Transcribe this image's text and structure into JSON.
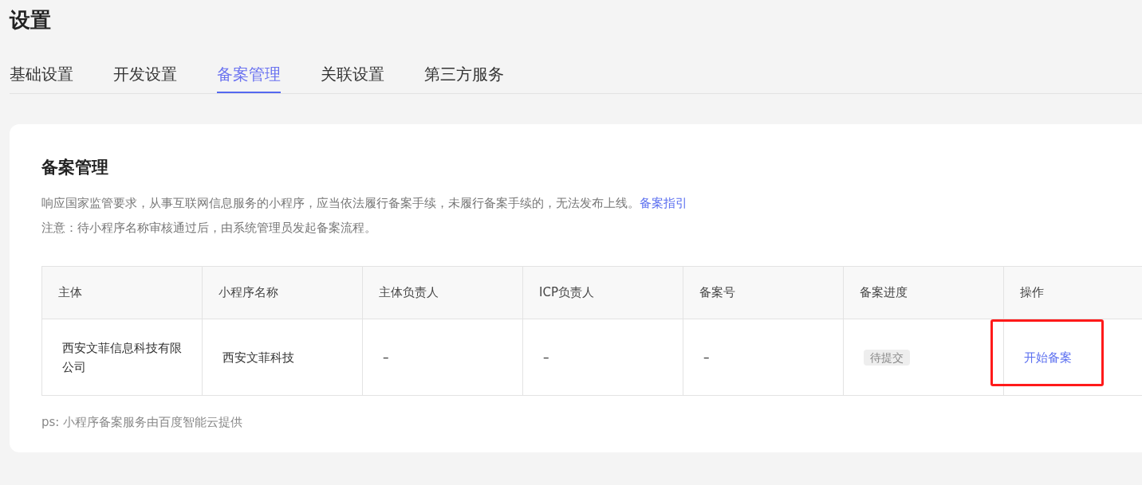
{
  "page_title": "设置",
  "tabs": [
    {
      "label": "基础设置",
      "selected": false
    },
    {
      "label": "开发设置",
      "selected": false
    },
    {
      "label": "备案管理",
      "selected": true
    },
    {
      "label": "关联设置",
      "selected": false
    },
    {
      "label": "第三方服务",
      "selected": false
    }
  ],
  "section": {
    "title": "备案管理",
    "notice": "响应国家监管要求，从事互联网信息服务的小程序，应当依法履行备案手续，未履行备案手续的，无法发布上线。",
    "guide_link": "备案指引",
    "note": "注意：待小程序名称审核通过后，由系统管理员发起备案流程。"
  },
  "table": {
    "columns": [
      "主体",
      "小程序名称",
      "主体负责人",
      "ICP负责人",
      "备案号",
      "备案进度",
      "操作"
    ],
    "rows": [
      {
        "subject": "西安文菲信息科技有限公司",
        "app_name": "西安文菲科技",
        "subject_owner": "–",
        "icp_owner": "–",
        "record_number": "–",
        "progress": "待提交",
        "action": {
          "label": "开始备案",
          "highlighted": true
        }
      }
    ]
  },
  "footnote": "ps: 小程序备案服务由百度智能云提供"
}
